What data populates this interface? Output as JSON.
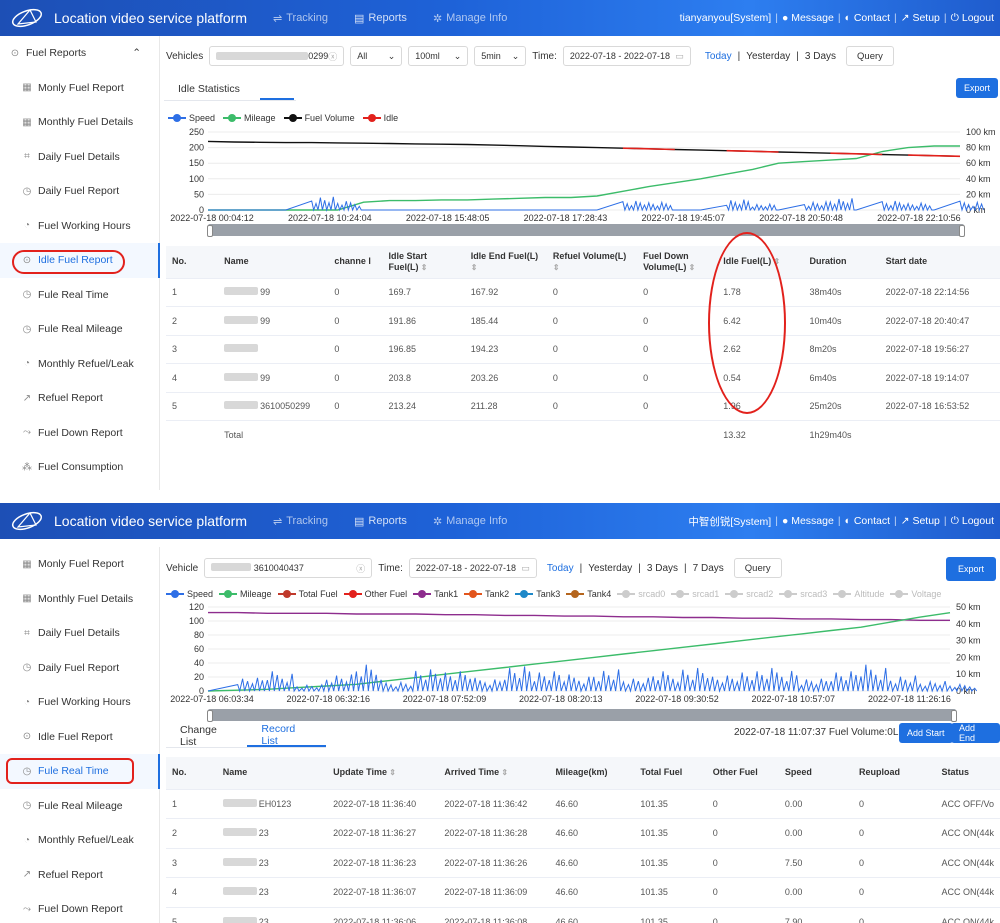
{
  "shot1": {
    "app_title": "Location video service platform",
    "nav": [
      "Tracking",
      "Reports",
      "Manage Info"
    ],
    "user": "tianyanyou[System]",
    "userlinks": [
      "Message",
      "Contact",
      "Setup",
      "Logout"
    ],
    "sidebar_head": "Fuel Reports",
    "sidebar": [
      "Monly Fuel Report",
      "Monthly Fuel Details",
      "Daily Fuel Details",
      "Daily Fuel Report",
      "Fuel Working Hours",
      "Idle Fuel Report",
      "Fule Real Time",
      "Fule Real Mileage",
      "Monthly Refuel/Leak",
      "Refuel Report",
      "Fuel Down Report",
      "Fuel Consumption"
    ],
    "toolbar": {
      "vehicles_label": "Vehicles",
      "vehicle_suffix": "0299",
      "all": "All",
      "dist": "100ml",
      "interval": "5min",
      "time_label": "Time:",
      "time_value": "2022-07-18 - 2022-07-18",
      "today": "Today",
      "yesterday": "Yesterday",
      "three_days": "3 Days",
      "query": "Query"
    },
    "tab": "Idle Statistics",
    "export": "Export",
    "legend": [
      "Speed",
      "Mileage",
      "Fuel Volume",
      "Idle"
    ],
    "table": {
      "headers": [
        "No.",
        "Name",
        "channe l",
        "Idle Start Fuel(L)",
        "Idle End Fuel(L)",
        "Refuel Volume(L)",
        "Fuel Down Volume(L)",
        "Idle Fuel(L)",
        "Duration",
        "Start date"
      ],
      "rows": [
        {
          "no": "1",
          "name": "99",
          "ch": "0",
          "start": "169.7",
          "end": "167.92",
          "refuel": "0",
          "down": "0",
          "idle": "1.78",
          "dur": "38m40s",
          "date": "2022-07-18 22:14:56"
        },
        {
          "no": "2",
          "name": "99",
          "ch": "0",
          "start": "191.86",
          "end": "185.44",
          "refuel": "0",
          "down": "0",
          "idle": "6.42",
          "dur": "10m40s",
          "date": "2022-07-18 20:40:47"
        },
        {
          "no": "3",
          "name": "",
          "ch": "0",
          "start": "196.85",
          "end": "194.23",
          "refuel": "0",
          "down": "0",
          "idle": "2.62",
          "dur": "8m20s",
          "date": "2022-07-18 19:56:27"
        },
        {
          "no": "4",
          "name": "99",
          "ch": "0",
          "start": "203.8",
          "end": "203.26",
          "refuel": "0",
          "down": "0",
          "idle": "0.54",
          "dur": "6m40s",
          "date": "2022-07-18 19:14:07"
        },
        {
          "no": "5",
          "name": "3610050299",
          "ch": "0",
          "start": "213.24",
          "end": "211.28",
          "refuel": "0",
          "down": "0",
          "idle": "1.96",
          "dur": "25m20s",
          "date": "2022-07-18 16:53:52"
        }
      ],
      "total_label": "Total",
      "total_idle": "13.32",
      "total_dur": "1h29m40s"
    }
  },
  "shot2": {
    "app_title": "Location video service platform",
    "nav": [
      "Tracking",
      "Reports",
      "Manage Info"
    ],
    "user": "中智创锐[System]",
    "userlinks": [
      "Message",
      "Contact",
      "Setup",
      "Logout"
    ],
    "sidebar": [
      "Monly Fuel Report",
      "Monthly Fuel Details",
      "Daily Fuel Details",
      "Daily Fuel Report",
      "Fuel Working Hours",
      "Idle Fuel Report",
      "Fule Real Time",
      "Fule Real Mileage",
      "Monthly Refuel/Leak",
      "Refuel Report",
      "Fuel Down Report"
    ],
    "toolbar": {
      "vehicle_label": "Vehicle",
      "vehicle_value": "3610040437",
      "time_label": "Time:",
      "time_value": "2022-07-18 - 2022-07-18",
      "today": "Today",
      "yesterday": "Yesterday",
      "three_days": "3 Days",
      "seven_days": "7 Days",
      "query": "Query"
    },
    "export": "Export",
    "legend": [
      "Speed",
      "Mileage",
      "Total Fuel",
      "Other Fuel",
      "Tank1",
      "Tank2",
      "Tank3",
      "Tank4",
      "srcad0",
      "srcad1",
      "srcad2",
      "srcad3",
      "Altitude",
      "Voltage"
    ],
    "tabs": [
      "Change List",
      "Record List"
    ],
    "fuel_info": "2022-07-18 11:07:37 Fuel Volume:0L",
    "add_start": "Add Start",
    "add_end": "Add End",
    "table": {
      "headers": [
        "No.",
        "Name",
        "Update Time",
        "Arrived Time",
        "Mileage(km)",
        "Total Fuel",
        "Other Fuel",
        "Speed",
        "Reupload",
        "Status"
      ],
      "rows": [
        {
          "no": "1",
          "name": "EH0123",
          "upd": "2022-07-18 11:36:40",
          "arr": "2022-07-18 11:36:42",
          "mil": "46.60",
          "fuel": "101.35",
          "other": "0",
          "speed": "0.00",
          "re": "0",
          "status": "ACC OFF/Vo"
        },
        {
          "no": "2",
          "name": "23",
          "upd": "2022-07-18 11:36:27",
          "arr": "2022-07-18 11:36:28",
          "mil": "46.60",
          "fuel": "101.35",
          "other": "0",
          "speed": "0.00",
          "re": "0",
          "status": "ACC ON(44k"
        },
        {
          "no": "3",
          "name": "23",
          "upd": "2022-07-18 11:36:23",
          "arr": "2022-07-18 11:36:26",
          "mil": "46.60",
          "fuel": "101.35",
          "other": "0",
          "speed": "7.50",
          "re": "0",
          "status": "ACC ON(44k"
        },
        {
          "no": "4",
          "name": "23",
          "upd": "2022-07-18 11:36:07",
          "arr": "2022-07-18 11:36:09",
          "mil": "46.60",
          "fuel": "101.35",
          "other": "0",
          "speed": "0.00",
          "re": "0",
          "status": "ACC ON(44k"
        },
        {
          "no": "5",
          "name": "23",
          "upd": "2022-07-18 11:36:06",
          "arr": "2022-07-18 11:36:08",
          "mil": "46.60",
          "fuel": "101.35",
          "other": "0",
          "speed": "7.90",
          "re": "0",
          "status": "ACC ON(44k"
        }
      ]
    }
  },
  "chart_data": [
    {
      "type": "line",
      "y_left_ticks": [
        "250",
        "200",
        "150",
        "100",
        "50",
        "0"
      ],
      "y_right_ticks": [
        "100 km",
        "80 km",
        "60 km",
        "40 km",
        "20 km",
        "0 km"
      ],
      "x_ticks": [
        "2022-07-18 00:04:12",
        "2022-07-18 10:24:04",
        "2022-07-18 15:48:05",
        "2022-07-18 17:28:43",
        "2022-07-18 19:45:07",
        "2022-07-18 20:50:48",
        "2022-07-18 22:10:56"
      ],
      "ylim": [
        0,
        250
      ],
      "y2lim": [
        0,
        100
      ],
      "series": [
        {
          "name": "Fuel Volume",
          "values": [
            220,
            218,
            217,
            216,
            216,
            215,
            214,
            213,
            212,
            211,
            210,
            208,
            206,
            204,
            202,
            200,
            198,
            196,
            194,
            192,
            190,
            188,
            186,
            184,
            182,
            180,
            178,
            176,
            174,
            172
          ]
        },
        {
          "name": "Mileage",
          "values": [
            0,
            0,
            0,
            0,
            0,
            0,
            10,
            12,
            12,
            13,
            13,
            14,
            15,
            16,
            16,
            18,
            24,
            30,
            35,
            40,
            46,
            52,
            60,
            62,
            64,
            66,
            75,
            80,
            82,
            82
          ]
        },
        {
          "name": "Speed",
          "values": [
            0,
            0,
            0,
            0,
            45,
            30,
            0,
            0,
            0,
            0,
            0,
            0,
            0,
            0,
            0,
            0,
            35,
            28,
            0,
            0,
            38,
            20,
            0,
            30,
            40,
            0,
            35,
            25,
            0,
            30
          ]
        }
      ],
      "grid": true
    },
    {
      "type": "line",
      "y_left_ticks": [
        "120",
        "100",
        "80",
        "60",
        "40",
        "20",
        "0"
      ],
      "y_right_ticks": [
        "50 km",
        "40 km",
        "30 km",
        "20 km",
        "10 km",
        "0 km"
      ],
      "x_ticks": [
        "2022-07-18 06:03:34",
        "2022-07-18 06:32:16",
        "2022-07-18 07:52:09",
        "2022-07-18 08:20:13",
        "2022-07-18 09:30:52",
        "2022-07-18 10:57:07",
        "2022-07-18 11:26:16"
      ],
      "ylim": [
        0,
        120
      ],
      "y2lim": [
        0,
        50
      ],
      "series": [
        {
          "name": "Total Fuel",
          "values": [
            112,
            112,
            111,
            111,
            111,
            110,
            110,
            110,
            109,
            109,
            108,
            108,
            107,
            107,
            106,
            106,
            105,
            105,
            104,
            104,
            103,
            103,
            102,
            102,
            101,
            101
          ]
        },
        {
          "name": "Mileage",
          "values": [
            0,
            0.5,
            1,
            2,
            3,
            4,
            6,
            8,
            10,
            12,
            14,
            16,
            18,
            20,
            22,
            24,
            26,
            28,
            30,
            32,
            34,
            36,
            38,
            41,
            44,
            46.6
          ]
        },
        {
          "name": "Speed",
          "values": [
            0,
            20,
            30,
            10,
            25,
            40,
            15,
            35,
            30,
            20,
            40,
            30,
            25,
            35,
            20,
            30,
            40,
            25,
            30,
            35,
            20,
            30,
            40,
            25,
            15,
            10
          ]
        }
      ],
      "grid": true
    }
  ]
}
